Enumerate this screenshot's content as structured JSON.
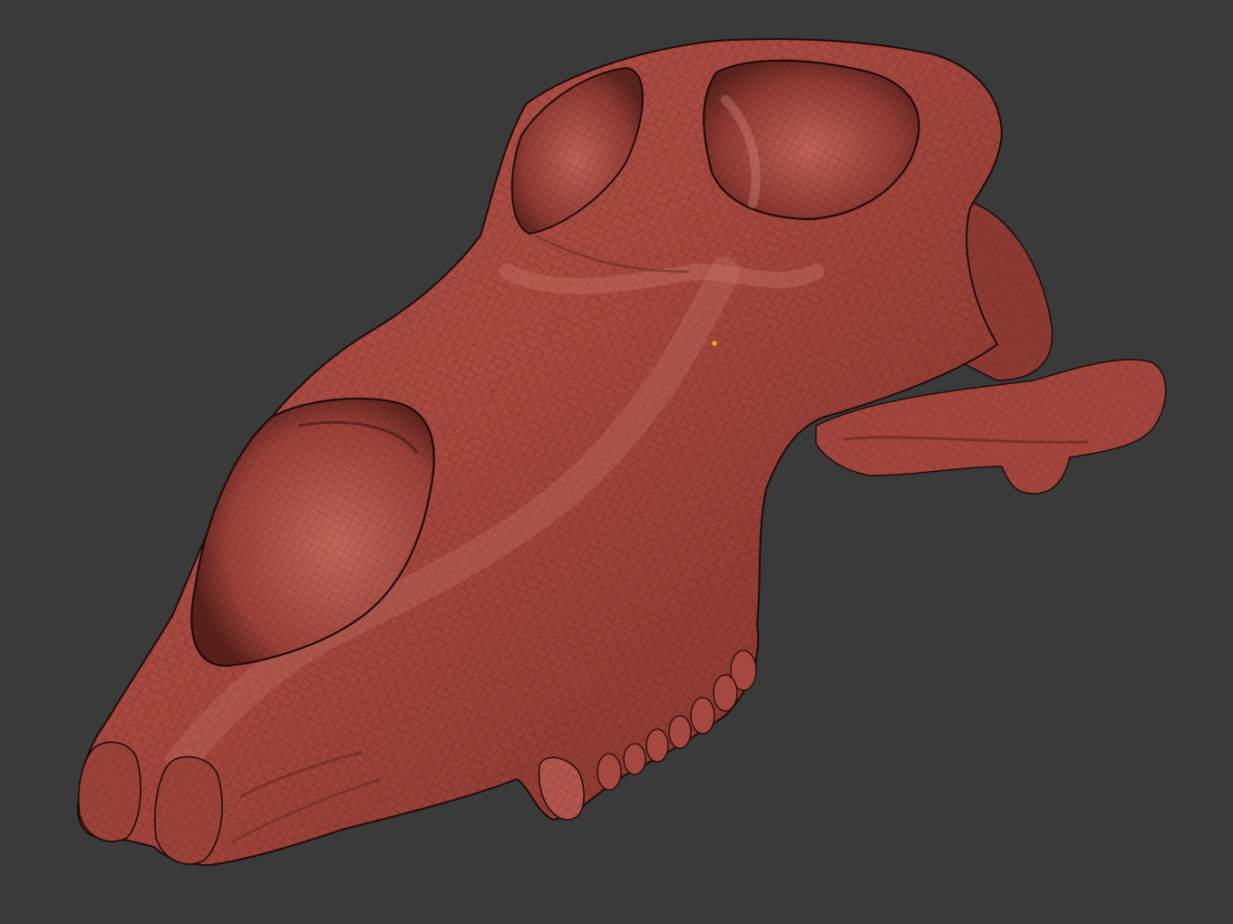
{
  "viewport": {
    "background_color": "#3a3a3a",
    "subject": "skull-mesh",
    "render_mode": "wireframe-on-shaded",
    "colors": {
      "surface": "#a34a42",
      "surface_light": "#c8716a",
      "surface_dark": "#6e2a24",
      "wire": "#2a1210",
      "marker": "#f0b020"
    }
  }
}
